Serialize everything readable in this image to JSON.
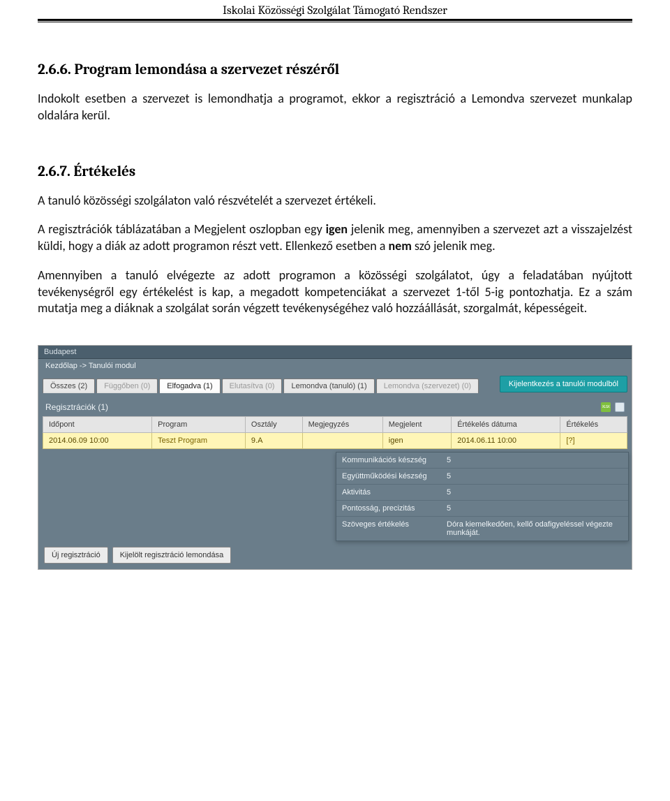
{
  "header": {
    "title": "Iskolai Közösségi Szolgálat Támogató Rendszer"
  },
  "section266": {
    "heading": "2.6.6. Program lemondása a szervezet részéről",
    "para": "Indokolt esetben a szervezet is lemondhatja a programot, ekkor a regisztráció a Lemondva szervezet munkalap oldalára kerül."
  },
  "section267": {
    "heading": "2.6.7. Értékelés",
    "para1": "A tanuló közösségi szolgálaton való részvételét a szervezet értékeli.",
    "para2_pre": "A regisztrációk táblázatában a Megjelent oszlopban egy ",
    "para2_b1": "igen",
    "para2_mid": " jelenik meg, amennyiben a szervezet azt a visszajelzést küldi, hogy a diák az adott programon részt vett. Ellenkező esetben a ",
    "para2_b2": "nem",
    "para2_post": " szó jelenik meg.",
    "para3": "Amennyiben a tanuló elvégezte az adott programon a közösségi szolgálatot, úgy a feladatában nyújtott tevékenységről egy értékelést is kap, a megadott kompetenciákat a szervezet 1-től 5-ig pontozhatja. Ez a szám mutatja meg a diáknak a szolgálat során végzett tevékenységéhez való hozzáállását, szorgalmát, képességeit."
  },
  "screenshot": {
    "crumb_city": "Budapest",
    "crumb_path": "Kezdőlap  ->  Tanulói modul",
    "tabs": [
      {
        "label": "Összes (2)",
        "active": false,
        "dim": false
      },
      {
        "label": "Függőben (0)",
        "active": false,
        "dim": true
      },
      {
        "label": "Elfogadva (1)",
        "active": true,
        "dim": false
      },
      {
        "label": "Elutasítva (0)",
        "active": false,
        "dim": true
      },
      {
        "label": "Lemondva (tanuló) (1)",
        "active": false,
        "dim": false
      },
      {
        "label": "Lemondva (szervezet) (0)",
        "active": false,
        "dim": true
      }
    ],
    "logout": "Kijelentkezés a tanulói modulból",
    "panel_title": "Regisztrációk (1)",
    "columns": [
      "Időpont",
      "Program",
      "Osztály",
      "Megjegyzés",
      "Megjelent",
      "Értékelés dátuma",
      "Értékelés"
    ],
    "row": {
      "idopont": "2014.06.09 10:00",
      "program": "Teszt Program",
      "osztaly": "9.A",
      "megjegyzes": "",
      "megjelent": "igen",
      "ertekeles_datuma": "2014.06.11 10:00",
      "ertekeles_link": "[?]"
    },
    "eval_popup": [
      {
        "k": "Kommunikációs készség",
        "v": "5"
      },
      {
        "k": "Együttműködési készség",
        "v": "5"
      },
      {
        "k": "Aktivitás",
        "v": "5"
      },
      {
        "k": "Pontosság, precizitás",
        "v": "5"
      },
      {
        "k": "Szöveges értékelés",
        "v": "Dóra kiemelkedően, kellő odafigyeléssel végezte munkáját."
      }
    ],
    "btn_new": "Új regisztráció",
    "btn_cancel": "Kijelölt regisztráció lemondása"
  }
}
